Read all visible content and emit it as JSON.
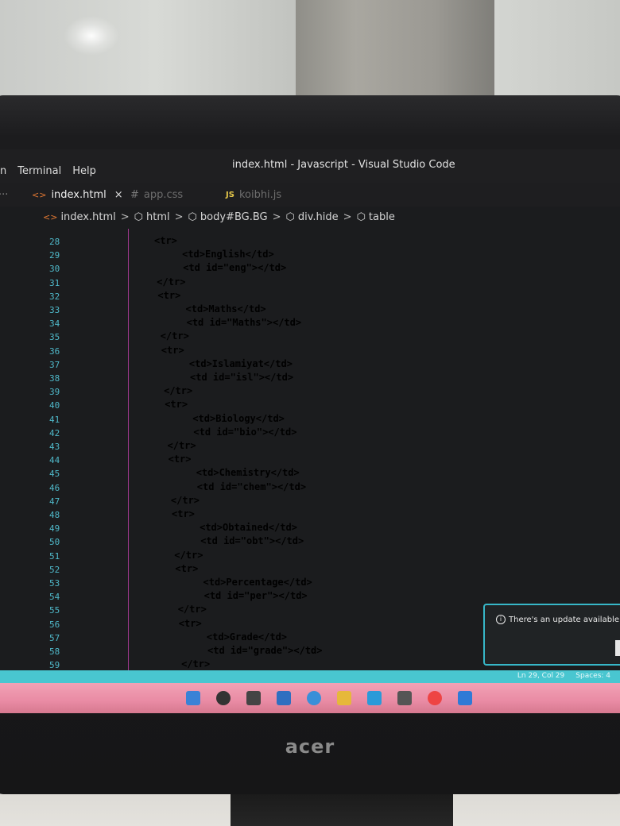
{
  "window": {
    "title": "index.html - Javascript - Visual Studio Code",
    "menu": [
      "n",
      "Terminal",
      "Help"
    ]
  },
  "tabs": [
    {
      "label": "index.html",
      "icon": "html-icon",
      "active": true,
      "close": "×"
    },
    {
      "label": "app.css",
      "icon": "css-icon",
      "prefix": "#",
      "active": false
    },
    {
      "label": "koibhi.js",
      "icon": "js-icon",
      "prefix": "JS",
      "active": false
    }
  ],
  "breadcrumb": [
    "index.html",
    "html",
    "body#BG.BG",
    "div.hide",
    "table"
  ],
  "code_lines": [
    {
      "n": "28",
      "text": "<tr>"
    },
    {
      "n": "29",
      "text": "<td>English</td>"
    },
    {
      "n": "30",
      "text": "<td id=\"eng\"></td>"
    },
    {
      "n": "31",
      "text": "</tr>"
    },
    {
      "n": "32",
      "text": "<tr>"
    },
    {
      "n": "33",
      "text": "<td>Maths</td>"
    },
    {
      "n": "34",
      "text": "<td id=\"Maths\"></td>"
    },
    {
      "n": "35",
      "text": "</tr>"
    },
    {
      "n": "36",
      "text": "<tr>"
    },
    {
      "n": "37",
      "text": "<td>Islamiyat</td>"
    },
    {
      "n": "38",
      "text": "<td id=\"isl\"></td>"
    },
    {
      "n": "39",
      "text": "</tr>"
    },
    {
      "n": "40",
      "text": "<tr>"
    },
    {
      "n": "41",
      "text": "<td>Biology</td>"
    },
    {
      "n": "42",
      "text": "<td id=\"bio\"></td>"
    },
    {
      "n": "43",
      "text": "</tr>"
    },
    {
      "n": "44",
      "text": "<tr>"
    },
    {
      "n": "45",
      "text": "<td>Chemistry</td>"
    },
    {
      "n": "46",
      "text": "<td id=\"chem\"></td>"
    },
    {
      "n": "47",
      "text": "</tr>"
    },
    {
      "n": "48",
      "text": "<tr>"
    },
    {
      "n": "49",
      "text": "<td>Obtained</td>"
    },
    {
      "n": "50",
      "text": "<td id=\"obt\"></td>"
    },
    {
      "n": "51",
      "text": "</tr>"
    },
    {
      "n": "52",
      "text": "<tr>"
    },
    {
      "n": "53",
      "text": "<td>Percentage</td>"
    },
    {
      "n": "54",
      "text": "<td id=\"per\"></td>"
    },
    {
      "n": "55",
      "text": "</tr>"
    },
    {
      "n": "56",
      "text": "<tr>"
    },
    {
      "n": "57",
      "text": "<td>Grade</td>"
    },
    {
      "n": "58",
      "text": "<td id=\"grade\"></td>"
    },
    {
      "n": "59",
      "text": "</tr>"
    }
  ],
  "notification": {
    "text": "There's an update available",
    "icon": "info-icon"
  },
  "statusbar": {
    "position": "Ln 29, Col 29",
    "spaces": "Spaces: 4"
  },
  "taskbar_icons": [
    "windows-start-icon",
    "search-icon",
    "task-view-icon",
    "widgets-icon",
    "chat-icon",
    "file-explorer-icon",
    "edge-icon",
    "store-icon",
    "chrome-icon",
    "vscode-icon"
  ],
  "monitor": {
    "brand": "acer"
  },
  "colors": {
    "accent": "#49c6d0",
    "line_numbers": "#4fb8c9",
    "indent_guide": "#b43ca0"
  }
}
